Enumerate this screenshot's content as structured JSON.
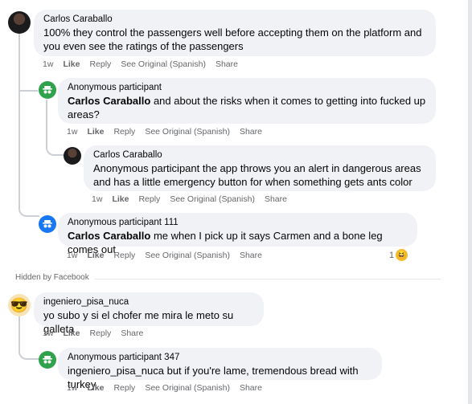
{
  "labels": {
    "like": "Like",
    "reply": "Reply",
    "see_original": "See Original (Spanish)",
    "share": "Share",
    "hidden_by": "Hidden by Facebook"
  },
  "comments": [
    {
      "author": "Carlos Caraballo",
      "text": "100% they control the passengers well before accepting them on the platform and you even see the ratings of the passengers",
      "time": "1w"
    },
    {
      "author": "Anonymous participant",
      "mention": "Carlos Caraballo",
      "text": " and about the risks when it comes to getting into fucked up areas?",
      "time": "1w"
    },
    {
      "author": "Carlos Caraballo",
      "text": "Anonymous participant the app throws you an alert in dangerous areas and has a little emergency button for when something gets ants color",
      "time": "1w"
    },
    {
      "author": "Anonymous participant 111",
      "mention": "Carlos Caraballo",
      "text": " me when I pick up it says Carmen and a bone leg comes out",
      "time": "1w",
      "reaction_count": "1"
    },
    {
      "author": "ingeniero_pisa_nuca",
      "text": "yo subo y si el chofer me mira le meto su galleta",
      "time": "1w"
    },
    {
      "author": "Anonymous participant 347",
      "text": "ingeniero_pisa_nuca but if you're lame, tremendous bread with turkey",
      "time": "1w"
    }
  ]
}
